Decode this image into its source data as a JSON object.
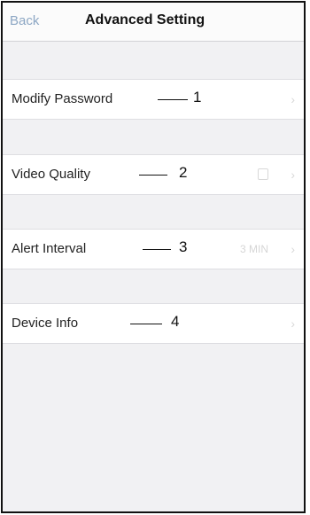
{
  "nav": {
    "back_label": "Back",
    "title": "Advanced Setting"
  },
  "rows": [
    {
      "label": "Modify Password",
      "callout": "1",
      "value": ""
    },
    {
      "label": "Video Quality",
      "callout": "2",
      "value": "",
      "value_icon": "hd-icon"
    },
    {
      "label": "Alert Interval",
      "callout": "3",
      "value": "3 MIN"
    },
    {
      "label": "Device Info",
      "callout": "4",
      "value": ""
    }
  ],
  "icons": {
    "chevron": "chevron-right-icon"
  },
  "colors": {
    "back_link": "#8da7c4",
    "background": "#f1f1f3",
    "row": "#ffffff",
    "muted": "#d6d6d6"
  }
}
